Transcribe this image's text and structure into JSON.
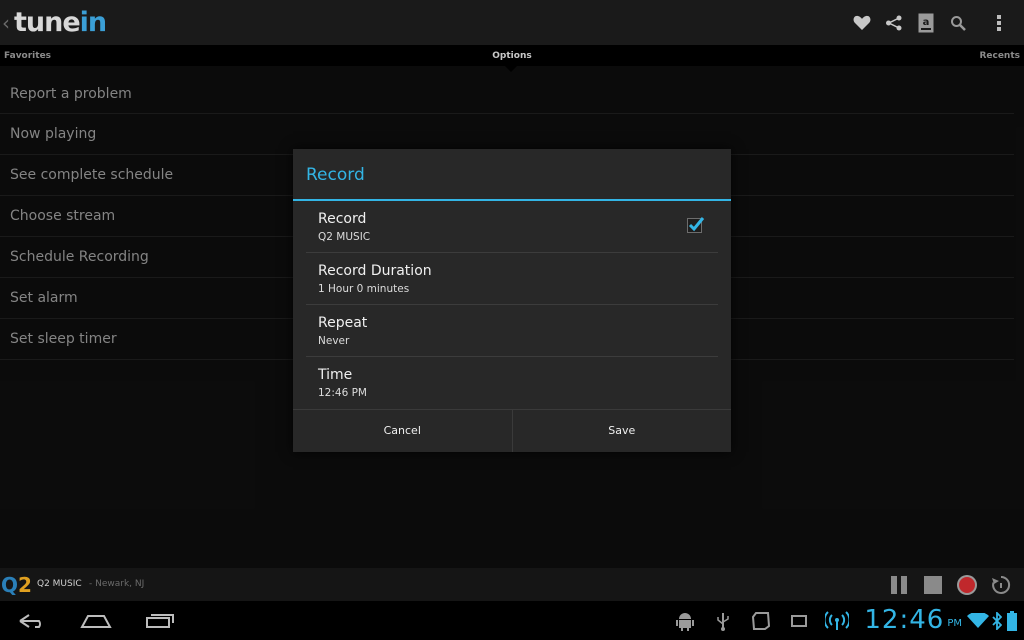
{
  "app": {
    "logo_text_primary": "tune",
    "logo_text_accent": "in",
    "logo_color_primary": "#d8d8d8",
    "logo_color_accent": "#3b9fd6",
    "action_icons": [
      "heart-icon",
      "share-icon",
      "amazon-icon",
      "search-icon",
      "overflow-menu-icon"
    ]
  },
  "tabs": {
    "left": "Favorites",
    "center": "Options",
    "right": "Recents"
  },
  "options": [
    "Report a problem",
    "Now playing",
    "See complete schedule",
    "Choose stream",
    "Schedule Recording",
    "Set alarm",
    "Set sleep timer"
  ],
  "dialog": {
    "title": "Record",
    "accent_color": "#33b5e5",
    "rows": [
      {
        "title": "Record",
        "subtitle": "Q2 MUSIC",
        "checked": true
      },
      {
        "title": "Record Duration",
        "subtitle": "1 Hour 0 minutes"
      },
      {
        "title": "Repeat",
        "subtitle": "Never"
      },
      {
        "title": "Time",
        "subtitle": "12:46 PM"
      }
    ],
    "cancel_label": "Cancel",
    "save_label": "Save"
  },
  "now_playing": {
    "station_logo_q": "Q",
    "station_logo_2": "2",
    "station": "Q2 MUSIC",
    "location": "- Newark, NJ",
    "controls": [
      "pause-icon",
      "stop-icon",
      "record-icon",
      "replay-icon"
    ]
  },
  "system_bar": {
    "nav": [
      "back-icon",
      "home-icon",
      "recent-apps-icon"
    ],
    "status_icons": [
      "android-debug-icon",
      "usb-icon",
      "sd-card-icon",
      "screen-rotation-icon",
      "wireless-signal-icon"
    ],
    "time": "12:46",
    "ampm": "PM",
    "trailing_icons": [
      "wifi-icon",
      "bluetooth-icon",
      "battery-icon"
    ]
  }
}
